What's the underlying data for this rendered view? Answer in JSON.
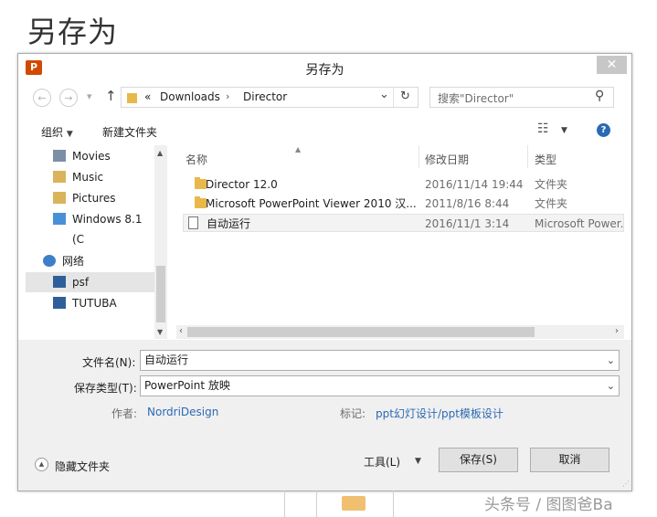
{
  "page_heading": "另存为",
  "dialog": {
    "title": "另存为",
    "app_icon_letter": "P",
    "close_glyph": "✕"
  },
  "nav": {
    "back": "←",
    "forward": "→",
    "recent": "▾",
    "up": "↑",
    "address_chevrons": "«",
    "path": [
      "Downloads",
      "Director"
    ],
    "path_sep": "›",
    "dropdown": "⌄",
    "refresh": "↻",
    "search_placeholder": "搜索\"Director\"",
    "search_glyph": "⚲"
  },
  "toolbar": {
    "organize": "组织",
    "new_folder": "新建文件夹",
    "view_glyph": "☷",
    "help_glyph": "?"
  },
  "sidebar": {
    "items": [
      {
        "label": "Movies",
        "icon": "movies-icon"
      },
      {
        "label": "Music",
        "icon": "music-icon"
      },
      {
        "label": "Pictures",
        "icon": "pictures-icon"
      },
      {
        "label": "Windows 8.1 (C",
        "icon": "drive-icon"
      },
      {
        "label": "网络",
        "icon": "network-icon"
      },
      {
        "label": "psf",
        "icon": "computer-icon"
      },
      {
        "label": "TUTUBA",
        "icon": "computer-icon"
      }
    ]
  },
  "filelist": {
    "columns": [
      "名称",
      "修改日期",
      "类型"
    ],
    "rows": [
      {
        "name": "Director 12.0",
        "date": "2016/11/14 19:44",
        "type": "文件夹",
        "kind": "folder"
      },
      {
        "name": "Microsoft PowerPoint Viewer 2010 汉...",
        "date": "2011/8/16 8:44",
        "type": "文件夹",
        "kind": "folder"
      },
      {
        "name": "自动运行",
        "date": "2016/11/1 3:14",
        "type": "Microsoft Power...",
        "kind": "file"
      }
    ]
  },
  "form": {
    "filename_label": "文件名(N):",
    "filename_value": "自动运行",
    "filetype_label": "保存类型(T):",
    "filetype_value": "PowerPoint 放映",
    "author_label": "作者:",
    "author_value": "NordriDesign",
    "tags_label": "标记:",
    "tags_value": "ppt幻灯设计/ppt模板设计"
  },
  "footer": {
    "hide_folders": "隐藏文件夹",
    "tools": "工具(L)",
    "save": "保存(S)",
    "cancel": "取消"
  },
  "watermark": "头条号 / 图图爸Ba",
  "colors": {
    "accent": "#2b6ab3",
    "app_icon": "#d04a02",
    "folder": "#e8b94a"
  }
}
